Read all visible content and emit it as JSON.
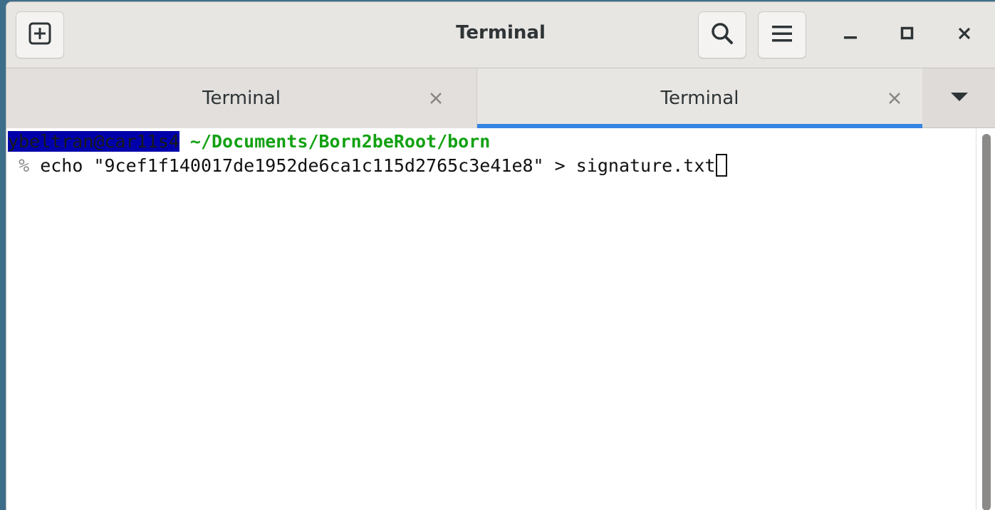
{
  "window": {
    "title": "Terminal"
  },
  "header": {
    "new_tab_icon": "plus-square-icon",
    "search_icon": "search-icon",
    "menu_icon": "hamburger-menu-icon",
    "minimize_icon": "minimize-icon",
    "maximize_icon": "maximize-icon",
    "close_icon": "close-icon"
  },
  "tabs": [
    {
      "label": "Terminal",
      "active": false
    },
    {
      "label": "Terminal",
      "active": true
    }
  ],
  "terminal": {
    "user_host": "ybeltran@car11s4",
    "path": "~/Documents/Born2beRoot/born",
    "prompt_symbol": "%",
    "command": "echo \"9cef1f140017de1952de6ca1c115d2765c3e41e8\" > signature.txt"
  },
  "colors": {
    "accent": "#3584e4",
    "path_green": "#12a112",
    "user_host_bg": "#0000aa"
  }
}
